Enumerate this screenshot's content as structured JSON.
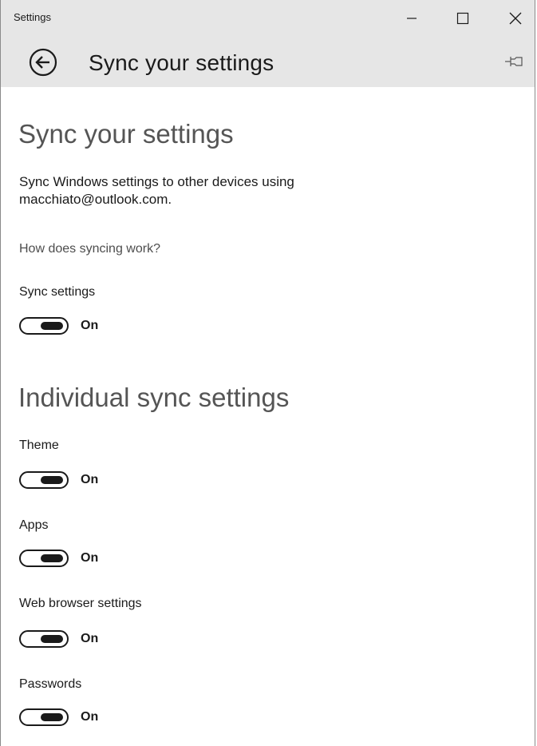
{
  "window": {
    "title": "Settings",
    "controls": {
      "minimize_icon": "minimize-icon",
      "maximize_icon": "maximize-icon",
      "close_icon": "close-icon"
    }
  },
  "header": {
    "back_icon": "back-arrow-icon",
    "title": "Sync your settings",
    "pin_icon": "pin-icon"
  },
  "main": {
    "heading": "Sync your settings",
    "description_line1": "Sync Windows settings to other devices using",
    "description_line2": "macchiato@outlook.com.",
    "help_link": "How does syncing work?",
    "sync_settings": {
      "label": "Sync settings",
      "state": "On",
      "enabled": true
    }
  },
  "individual": {
    "heading": "Individual sync settings",
    "items": [
      {
        "label": "Theme",
        "state": "On",
        "enabled": true
      },
      {
        "label": "Apps",
        "state": "On",
        "enabled": true
      },
      {
        "label": "Web browser settings",
        "state": "On",
        "enabled": true
      },
      {
        "label": "Passwords",
        "state": "On",
        "enabled": true
      }
    ]
  },
  "colors": {
    "titlebar_bg": "#e6e6e6",
    "text": "#1a1a1a",
    "heading_gray": "#555555",
    "toggle": "#1a1a1a"
  }
}
